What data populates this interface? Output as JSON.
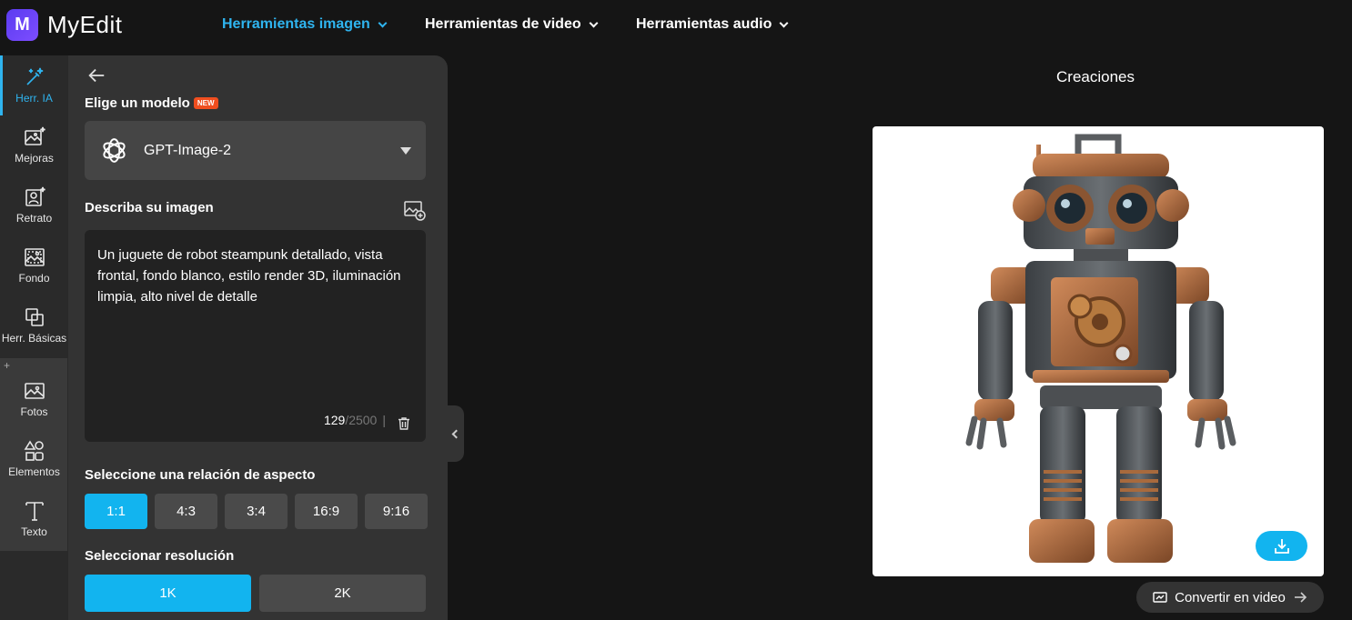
{
  "app": {
    "logo_letter": "M",
    "name": "MyEdit",
    "brand_color": "#6a44f5",
    "accent": "#12b4ef"
  },
  "nav": [
    {
      "label": "Herramientas imagen",
      "active": true
    },
    {
      "label": "Herramientas de video",
      "active": false
    },
    {
      "label": "Herramientas audio",
      "active": false
    }
  ],
  "rail": {
    "items": [
      {
        "label": "Herr. IA",
        "icon": "magic-wand-icon",
        "active": true
      },
      {
        "label": "Mejoras",
        "icon": "image-sparkle-icon"
      },
      {
        "label": "Retrato",
        "icon": "portrait-icon"
      },
      {
        "label": "Fondo",
        "icon": "background-icon"
      },
      {
        "label": "Herr. Básicas",
        "icon": "crop-icon"
      },
      {
        "label": "Fotos",
        "icon": "photo-icon"
      },
      {
        "label": "Elementos",
        "icon": "shapes-icon"
      },
      {
        "label": "Texto",
        "icon": "text-icon"
      }
    ],
    "plus": "+"
  },
  "panel": {
    "model_label": "Elige un modelo",
    "new_badge": "NEW",
    "model_value": "GPT-Image-2",
    "describe_label": "Describa su imagen",
    "prompt_text": "Un juguete de robot steampunk detallado, vista frontal, fondo blanco, estilo render 3D, iluminación limpia, alto nivel de detalle",
    "char_count": "129",
    "char_max": "/2500",
    "separator": "|",
    "aspect_label": "Seleccione una relación de aspecto",
    "aspect_options": [
      "1:1",
      "4:3",
      "3:4",
      "16:9",
      "9:16"
    ],
    "aspect_selected": "1:1",
    "resolution_label": "Seleccionar resolución",
    "resolution_options": [
      "1K",
      "2K"
    ],
    "resolution_selected": "1K"
  },
  "main": {
    "title": "Creaciones",
    "convert_label": "Convertir en video"
  }
}
